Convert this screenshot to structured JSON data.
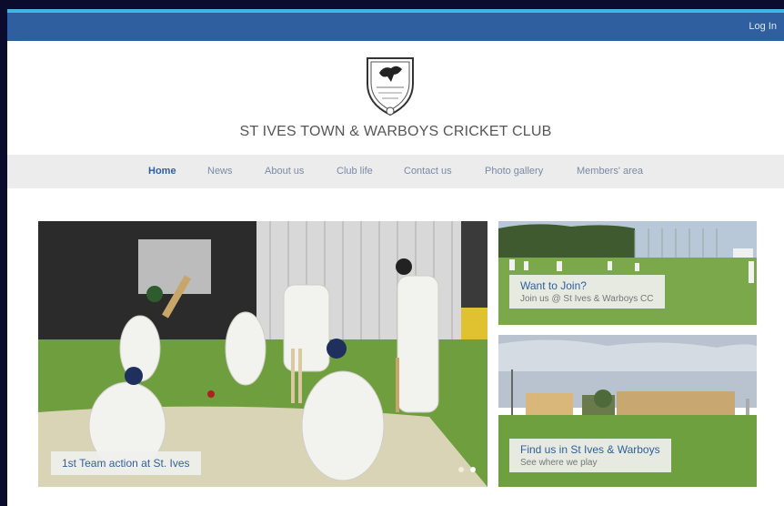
{
  "header": {
    "login_label": "Log In"
  },
  "club": {
    "title": "ST IVES TOWN & WARBOYS CRICKET CLUB"
  },
  "nav": {
    "items": [
      {
        "label": "Home"
      },
      {
        "label": "News"
      },
      {
        "label": "About us"
      },
      {
        "label": "Club life"
      },
      {
        "label": "Contact us"
      },
      {
        "label": "Photo gallery"
      },
      {
        "label": "Members' area"
      }
    ]
  },
  "hero": {
    "caption": "1st Team action at St. Ives"
  },
  "panels": [
    {
      "title": "Want to Join?",
      "subtitle": "Join us @ St Ives & Warboys CC"
    },
    {
      "title": "Find us in St Ives & Warboys",
      "subtitle": "See where we play"
    }
  ],
  "colors": {
    "brand": "#2f5f9e",
    "accent": "#3fb5e8",
    "nav_bg": "#ececec"
  }
}
